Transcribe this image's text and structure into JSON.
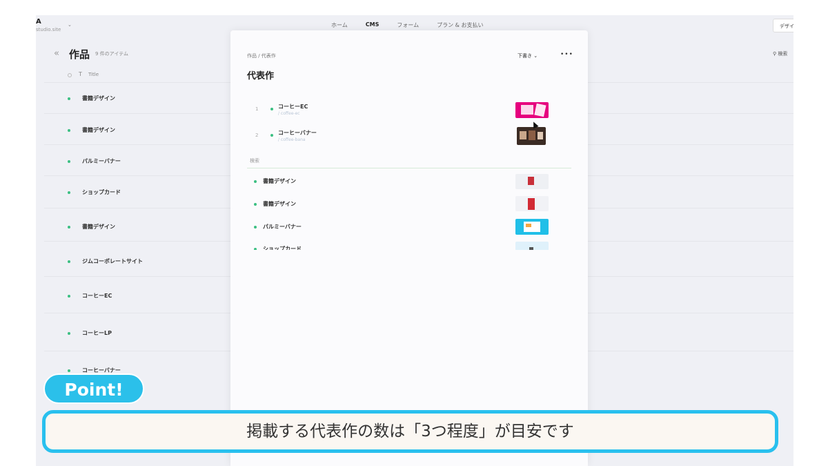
{
  "app": {
    "site_title": "A",
    "site_sub": "studio.site",
    "nav": [
      "ホーム",
      "CMS",
      "フォーム",
      "プラン & お支払い"
    ],
    "active_nav": "CMS",
    "design_label": "デザイン",
    "search_label": "検索"
  },
  "collection": {
    "title": "作品",
    "count": "9 件のアイテム",
    "column_title": "Title",
    "items": [
      "書籍デザイン",
      "書籍デザイン",
      "パルミーバナー",
      "ショップカード",
      "書籍デザイン",
      "ジムコーポレートサイト",
      "コーヒーEC",
      "コーヒーLP",
      "コーヒーバナー"
    ]
  },
  "modal": {
    "breadcrumb": "作品 / 代表作",
    "status": "下書き",
    "more": "•••",
    "title": "代表作",
    "selected": [
      {
        "num": "1",
        "name": "コーヒーEC",
        "slug": "/ coffee-ec"
      },
      {
        "num": "2",
        "name": "コーヒーバナー",
        "slug": "/ coffee-bana"
      }
    ],
    "search_label": "検索",
    "results": [
      "書籍デザイン",
      "書籍デザイン",
      "パルミーバナー",
      "ショップカード"
    ]
  },
  "overlay": {
    "point_label": "Point!",
    "caption": "掲載する代表作の数は「3つ程度」が目安です"
  },
  "colors": {
    "accent": "#29c0ee",
    "status_dot": "#3bbf82"
  }
}
